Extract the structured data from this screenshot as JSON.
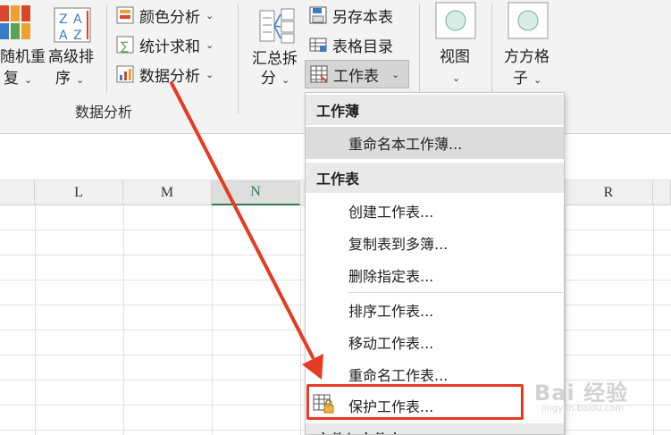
{
  "ribbon": {
    "random_repeat_line1": "随机重",
    "random_repeat_line2": "复",
    "advanced_sort_line1": "高级排",
    "advanced_sort_line2": "序",
    "color_analysis": "颜色分析",
    "stat_sum": "统计求和",
    "data_analysis": "数据分析",
    "group_label": "数据分析",
    "summary_split_line1": "汇总拆",
    "summary_split_line2": "分",
    "save_sheet": "另存本表",
    "table_catalog": "表格目录",
    "worksheet": "工作表",
    "view": "视图",
    "grid_line1": "方方格",
    "grid_line2": "子"
  },
  "columns": [
    "L",
    "M",
    "N",
    "R"
  ],
  "menu": {
    "section1": "工作薄",
    "rename_workbook": "重命名本工作薄...",
    "section2": "工作表",
    "create_sheet": "创建工作表...",
    "copy_sheet": "复制表到多簿...",
    "delete_sheet": "删除指定表...",
    "sort_sheet": "排序工作表...",
    "move_sheet": "移动工作表...",
    "rename_sheet": "重命名工作表...",
    "protect_sheet": "保护工作表...",
    "section3": "文件与文件夹"
  },
  "watermark": {
    "text": "Bai 经验",
    "sub": "jingyan.baidu.com"
  },
  "colors": {
    "highlight_red": "#e53a24",
    "ribbon_bg": "#f3f3f3",
    "menu_header_bg": "#e9e9e9"
  }
}
